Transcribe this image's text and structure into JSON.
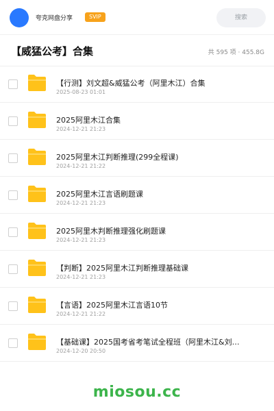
{
  "header": {
    "brand": "夸克网盘分享",
    "badge": "SVIP",
    "search_label": "搜索"
  },
  "title": {
    "text": "【威猛公考】合集",
    "meta": "共 595 项 · 455.8G"
  },
  "items": [
    {
      "name": "【行测】刘文超&威猛公考（阿里木江）合集",
      "date": "2025-08-23 01:01"
    },
    {
      "name": "2025阿里木江合集",
      "date": "2024-12-21 21:23"
    },
    {
      "name": "2025阿里木江判断推理(299全程课)",
      "date": "2024-12-21 21:22"
    },
    {
      "name": "2025阿里木江言语刷题课",
      "date": "2024-12-21 21:23"
    },
    {
      "name": "2025阿里木判断推理强化刷题课",
      "date": "2024-12-21 21:23"
    },
    {
      "name": "【判断】2025阿里木江判断推理基础课",
      "date": "2024-12-21 21:23"
    },
    {
      "name": "【言语】2025阿里木江言语10节",
      "date": "2024-12-21 21:22"
    },
    {
      "name": "【基础课】2025国考省考笔试全程班（阿里木江&刘…",
      "date": "2024-12-20 20:50"
    }
  ],
  "icons": {
    "folder": "folder-icon",
    "avatar": "user-avatar"
  },
  "colors": {
    "accent": "#2979ff",
    "svip": "#f7a21b",
    "folder": "#ffc21a",
    "watermark": "#3cb44b"
  },
  "watermark": "miosou.cc"
}
